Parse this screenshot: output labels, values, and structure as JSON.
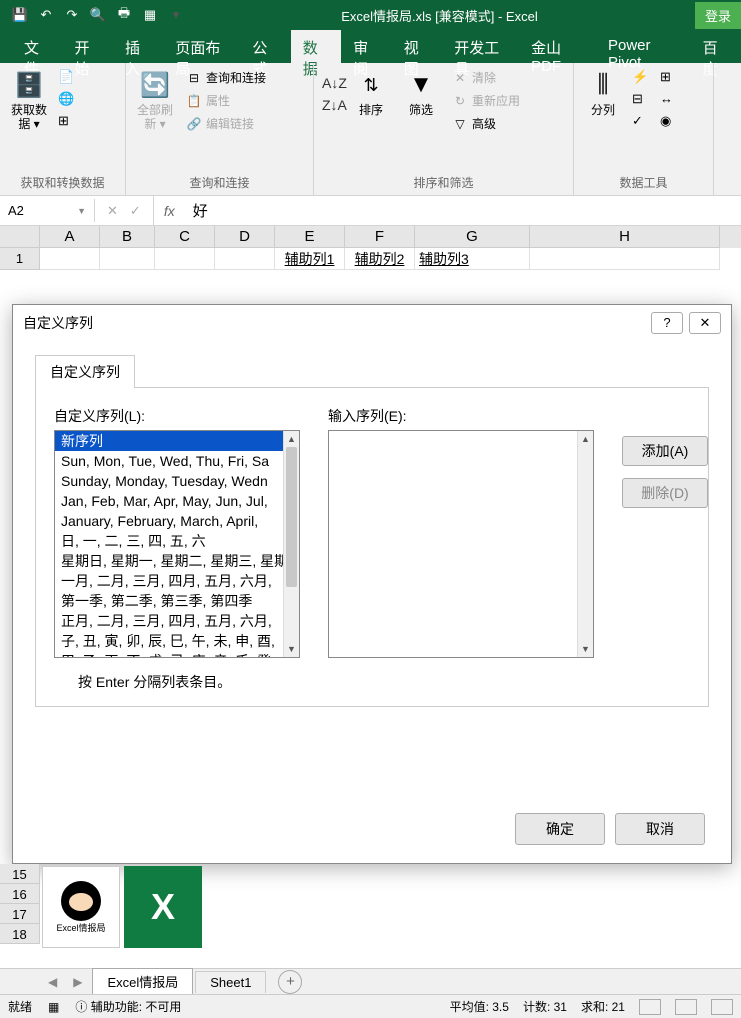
{
  "titlebar": {
    "title": "Excel情报局.xls  [兼容模式]  -  Excel",
    "login": "登录"
  },
  "menu": {
    "tabs": [
      "文件",
      "开始",
      "插入",
      "页面布局",
      "公式",
      "数据",
      "审阅",
      "视图",
      "开发工具",
      "金山PDF",
      "Power Pivot",
      "百度"
    ],
    "active_index": 5
  },
  "ribbon": {
    "group1": {
      "big": "获取数\n据 ▾",
      "label": "获取和转换数据"
    },
    "group2": {
      "big": "全部刷新\n▾",
      "items": [
        "查询和连接",
        "属性",
        "编辑链接"
      ],
      "label": "查询和连接"
    },
    "group3": {
      "sort": "排序",
      "filter": "筛选",
      "items": [
        "清除",
        "重新应用",
        "高级"
      ],
      "label": "排序和筛选"
    },
    "group4": {
      "big": "分列",
      "label": "数据工具"
    }
  },
  "formulabar": {
    "name": "A2",
    "value": "好"
  },
  "grid": {
    "cols": [
      "A",
      "B",
      "C",
      "D",
      "E",
      "F",
      "G",
      "H"
    ],
    "row1": {
      "e": "辅助列1",
      "f": "辅助列2",
      "g": "辅助列3"
    },
    "rows_bottom": [
      "15",
      "16",
      "17",
      "18"
    ]
  },
  "dialog": {
    "title": "自定义序列",
    "tab": "自定义序列",
    "list_label": "自定义序列(L):",
    "entry_label": "输入序列(E):",
    "add": "添加(A)",
    "delete": "删除(D)",
    "hint": "按 Enter 分隔列表条目。",
    "ok": "确定",
    "cancel": "取消",
    "list": [
      "新序列",
      "Sun, Mon, Tue, Wed, Thu, Fri, Sa",
      "Sunday, Monday, Tuesday, Wedn",
      "Jan, Feb, Mar, Apr, May, Jun, Jul,",
      "January, February, March, April,",
      "日, 一, 二, 三, 四, 五, 六",
      "星期日, 星期一, 星期二, 星期三, 星期",
      "一月, 二月, 三月, 四月, 五月, 六月,",
      "第一季, 第二季, 第三季, 第四季",
      "正月, 二月, 三月, 四月, 五月, 六月,",
      "子, 丑, 寅, 卯, 辰, 巳, 午, 未, 申, 酉,",
      "甲, 乙, 丙, 丁, 戊, 己, 庚, 辛, 壬, 癸"
    ],
    "selected_index": 0
  },
  "logos": {
    "label": "Excel情报局"
  },
  "sheets": {
    "tabs": [
      "Excel情报局",
      "Sheet1"
    ],
    "active": 0
  },
  "status": {
    "ready": "就绪",
    "access": "辅助功能: 不可用",
    "avg": "平均值: 3.5",
    "count": "计数: 31",
    "sum": "求和: 21"
  }
}
